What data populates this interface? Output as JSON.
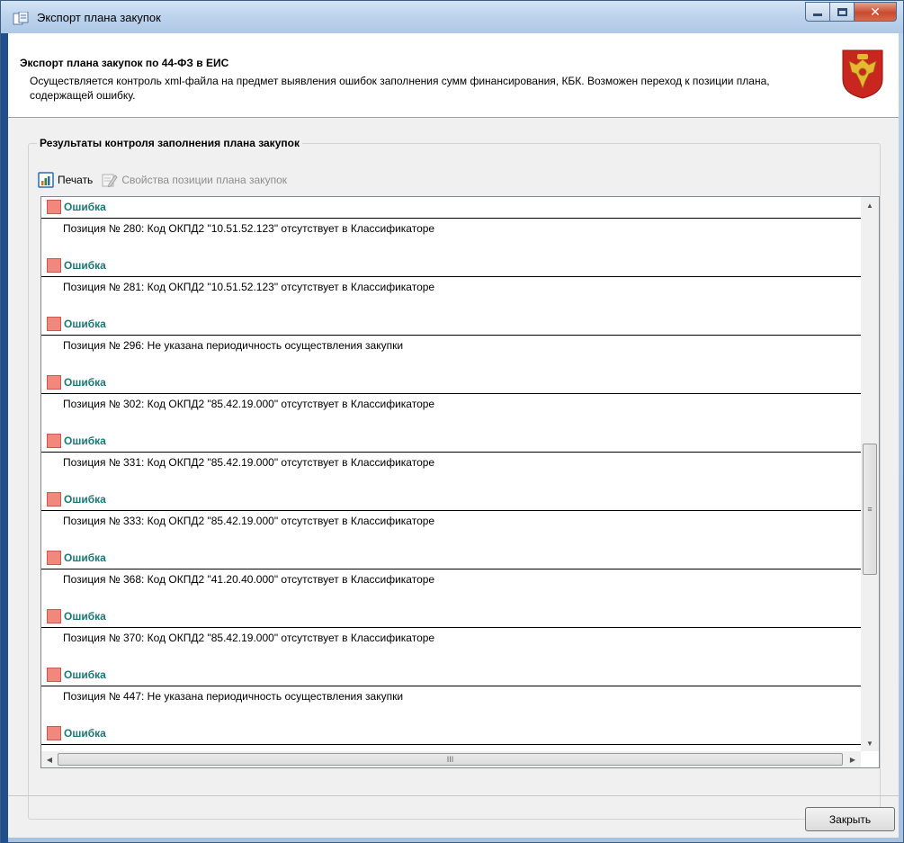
{
  "window": {
    "title": "Экспорт плана закупок"
  },
  "header": {
    "title": "Экспорт плана закупок по 44-ФЗ в ЕИС",
    "description": "Осуществляется контроль xml-файла на предмет выявления ошибок заполнения сумм финансирования, КБК. Возможен переход к позиции плана, содержащей ошибку."
  },
  "group": {
    "title": "Результаты контроля заполнения плана закупок"
  },
  "toolbar": {
    "print_label": "Печать",
    "properties_label": "Свойства позиции плана закупок"
  },
  "results": [
    {
      "label": "Ошибка",
      "message": "Позиция № 280: Код ОКПД2 \"10.51.52.123\" отсутствует в Классификаторе"
    },
    {
      "label": "Ошибка",
      "message": "Позиция № 281: Код ОКПД2 \"10.51.52.123\" отсутствует в Классификаторе"
    },
    {
      "label": "Ошибка",
      "message": "Позиция № 296: Не указана периодичность осуществления закупки"
    },
    {
      "label": "Ошибка",
      "message": "Позиция № 302: Код ОКПД2 \"85.42.19.000\" отсутствует в Классификаторе"
    },
    {
      "label": "Ошибка",
      "message": "Позиция № 331: Код ОКПД2 \"85.42.19.000\" отсутствует в Классификаторе"
    },
    {
      "label": "Ошибка",
      "message": "Позиция № 333: Код ОКПД2 \"85.42.19.000\" отсутствует в Классификаторе"
    },
    {
      "label": "Ошибка",
      "message": "Позиция № 368: Код ОКПД2 \"41.20.40.000\" отсутствует в Классификаторе"
    },
    {
      "label": "Ошибка",
      "message": "Позиция № 370: Код ОКПД2 \"85.42.19.000\" отсутствует в Классификаторе"
    },
    {
      "label": "Ошибка",
      "message": "Позиция № 447: Не указана периодичность осуществления закупки"
    },
    {
      "label": "Ошибка",
      "message": ""
    }
  ],
  "footer": {
    "close_label": "Закрыть"
  },
  "colors": {
    "error_square": "#f0887e",
    "error_label": "#1a7a75"
  }
}
